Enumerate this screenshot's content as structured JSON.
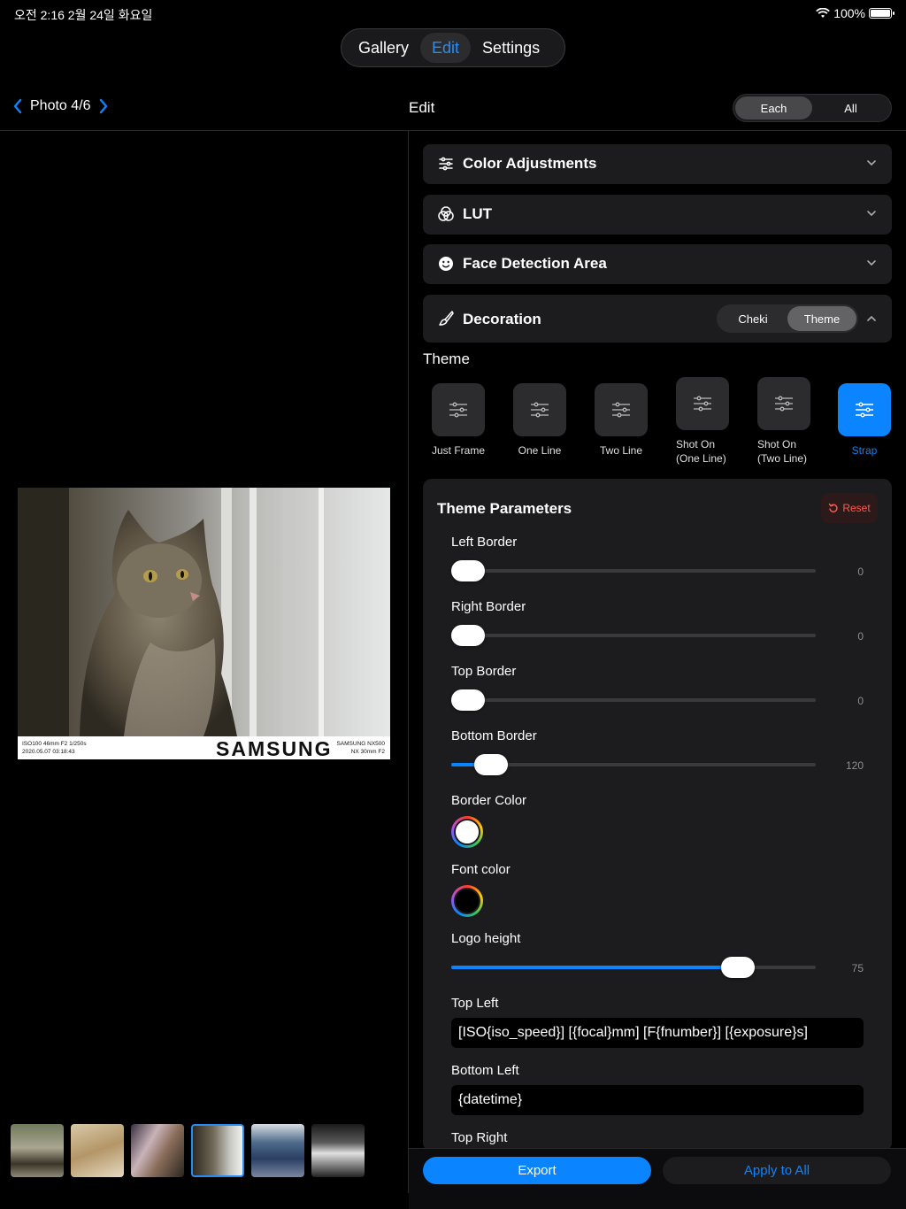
{
  "status_bar": {
    "time": "오전 2:16  2월 24일 화요일",
    "battery": "100%"
  },
  "top_tabs": [
    {
      "label": "Gallery",
      "active": false
    },
    {
      "label": "Edit",
      "active": true
    },
    {
      "label": "Settings",
      "active": false
    }
  ],
  "header": {
    "photo_label": "Photo 4/6",
    "title": "Edit",
    "scope_options": [
      "Each",
      "All"
    ],
    "scope_selected": "Each"
  },
  "sections": {
    "color_adjustments": "Color Adjustments",
    "lut": "LUT",
    "face_detection": "Face Detection Area",
    "decoration": "Decoration",
    "decoration_modes": [
      "Cheki",
      "Theme"
    ],
    "decoration_mode_selected": "Theme"
  },
  "theme": {
    "heading": "Theme",
    "options": [
      {
        "label": "Just Frame",
        "active": false
      },
      {
        "label": "One Line",
        "active": false
      },
      {
        "label": "Two Line",
        "active": false
      },
      {
        "label": "Shot On\n(One Line)",
        "active": false
      },
      {
        "label": "Shot On\n(Two Line)",
        "active": false
      },
      {
        "label": "Strap",
        "active": true
      }
    ]
  },
  "theme_parameters": {
    "heading": "Theme Parameters",
    "reset_label": "Reset",
    "left_border": {
      "label": "Left Border",
      "value": "0",
      "fraction": 0.0
    },
    "right_border": {
      "label": "Right Border",
      "value": "0",
      "fraction": 0.0
    },
    "top_border": {
      "label": "Top Border",
      "value": "0",
      "fraction": 0.0
    },
    "bottom_border": {
      "label": "Bottom Border",
      "value": "120",
      "fraction": 0.11
    },
    "border_color": {
      "label": "Border Color",
      "color": "#ffffff"
    },
    "font_color": {
      "label": "Font color",
      "color": "#000000"
    },
    "logo_height": {
      "label": "Logo height",
      "value": "75",
      "fraction": 0.787
    },
    "top_left": {
      "label": "Top Left",
      "value": "[ISO{iso_speed}] [{focal}mm] [F{fnumber}] [{exposure}s]"
    },
    "bottom_left": {
      "label": "Bottom Left",
      "value": "{datetime}"
    },
    "top_right": {
      "label": "Top Right"
    }
  },
  "photo_strap": {
    "top_left_text": "ISO100 46mm F2 1/250s",
    "bottom_left_text": "2020.05.07 03:18:43",
    "logo": "SAMSUNG",
    "top_right_text": "SAMSUNG NX500",
    "bottom_right_text": "NX 30mm F2"
  },
  "actions": {
    "export": "Export",
    "apply_all": "Apply to All"
  },
  "colors": {
    "accent": "#0a84ff",
    "reset": "#ff5a4f",
    "panel": "#1c1c1e"
  }
}
